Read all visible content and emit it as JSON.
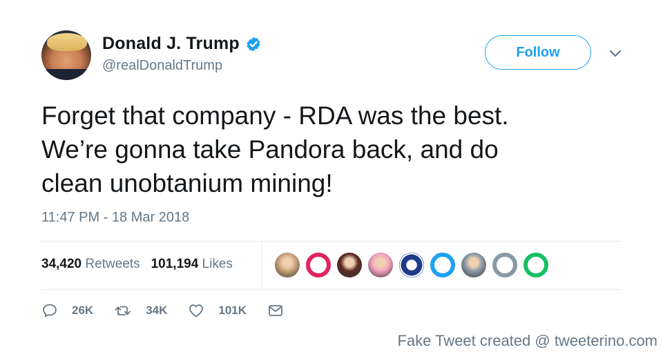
{
  "author": {
    "display_name": "Donald J. Trump",
    "handle": "@realDonaldTrump",
    "verified": true
  },
  "follow_label": "Follow",
  "tweet": {
    "lines": [
      "Forget that company - RDA was the best.",
      "We’re gonna take Pandora back, and do",
      "clean unobtanium mining!"
    ],
    "timestamp": "11:47 PM - 18 Mar 2018"
  },
  "stats": {
    "retweets_count": "34,420",
    "retweets_label": "Retweets",
    "likes_count": "101,194",
    "likes_label": "Likes"
  },
  "liker_avatars": [
    {
      "kind": "photo",
      "color": "#c9a27a"
    },
    {
      "kind": "egg",
      "color": "#e0245e"
    },
    {
      "kind": "photo",
      "color": "#5a2a22"
    },
    {
      "kind": "photo",
      "color": "#f3a3c0"
    },
    {
      "kind": "badge",
      "color": "#1f3a8a"
    },
    {
      "kind": "egg",
      "color": "#1da1f2"
    },
    {
      "kind": "photo",
      "color": "#8a9aa8"
    },
    {
      "kind": "egg",
      "color": "#8899a6"
    },
    {
      "kind": "egg",
      "color": "#17bf63"
    }
  ],
  "actions": {
    "reply_count": "26K",
    "retweet_count": "34K",
    "like_count": "101K"
  },
  "icons": {
    "verified": "verified-badge-icon",
    "chevron": "chevron-down-icon",
    "reply": "reply-icon",
    "retweet": "retweet-icon",
    "like": "heart-icon",
    "message": "envelope-icon"
  },
  "colors": {
    "accent": "#1da1f2",
    "secondary_text": "#657786",
    "primary_text": "#14171a"
  },
  "footer": "Fake Tweet created @ tweeterino.com"
}
